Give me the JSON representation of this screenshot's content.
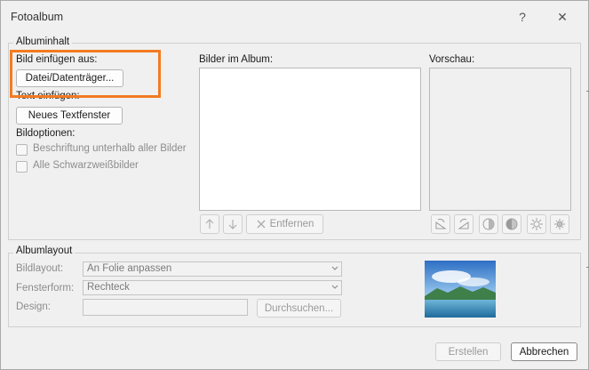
{
  "window": {
    "title": "Fotoalbum",
    "help_glyph": "?",
    "close_glyph": "✕"
  },
  "album_content": {
    "legend": "Albuminhalt",
    "insert_picture_from": "Bild einfügen aus:",
    "file_disk_button": "Datei/Datenträger...",
    "insert_text": "Text einfügen:",
    "new_textbox_button": "Neues Textfenster",
    "picture_options": "Bildoptionen:",
    "captions_below": "Beschriftung unterhalb aller Bilder",
    "all_black_white": "Alle Schwarzweißbilder",
    "pictures_in_album": "Bilder im Album:",
    "preview": "Vorschau:",
    "remove_button": "Entfernen"
  },
  "album_layout": {
    "legend": "Albumlayout",
    "picture_layout_label": "Bildlayout:",
    "picture_layout_value": "An Folie anpassen",
    "frame_shape_label": "Fensterform:",
    "frame_shape_value": "Rechteck",
    "theme_label": "Design:",
    "theme_value": "",
    "browse_button": "Durchsuchen..."
  },
  "footer": {
    "create_button": "Erstellen",
    "cancel_button": "Abbrechen"
  },
  "colors": {
    "highlight": "#f27b21",
    "dialog_bg": "#f0f0f0"
  },
  "icons": [
    "up-arrow-icon",
    "down-arrow-icon",
    "remove-x-icon",
    "rotate-left-icon",
    "rotate-right-icon",
    "contrast-up-icon",
    "contrast-down-icon",
    "brightness-up-icon",
    "brightness-down-icon"
  ]
}
